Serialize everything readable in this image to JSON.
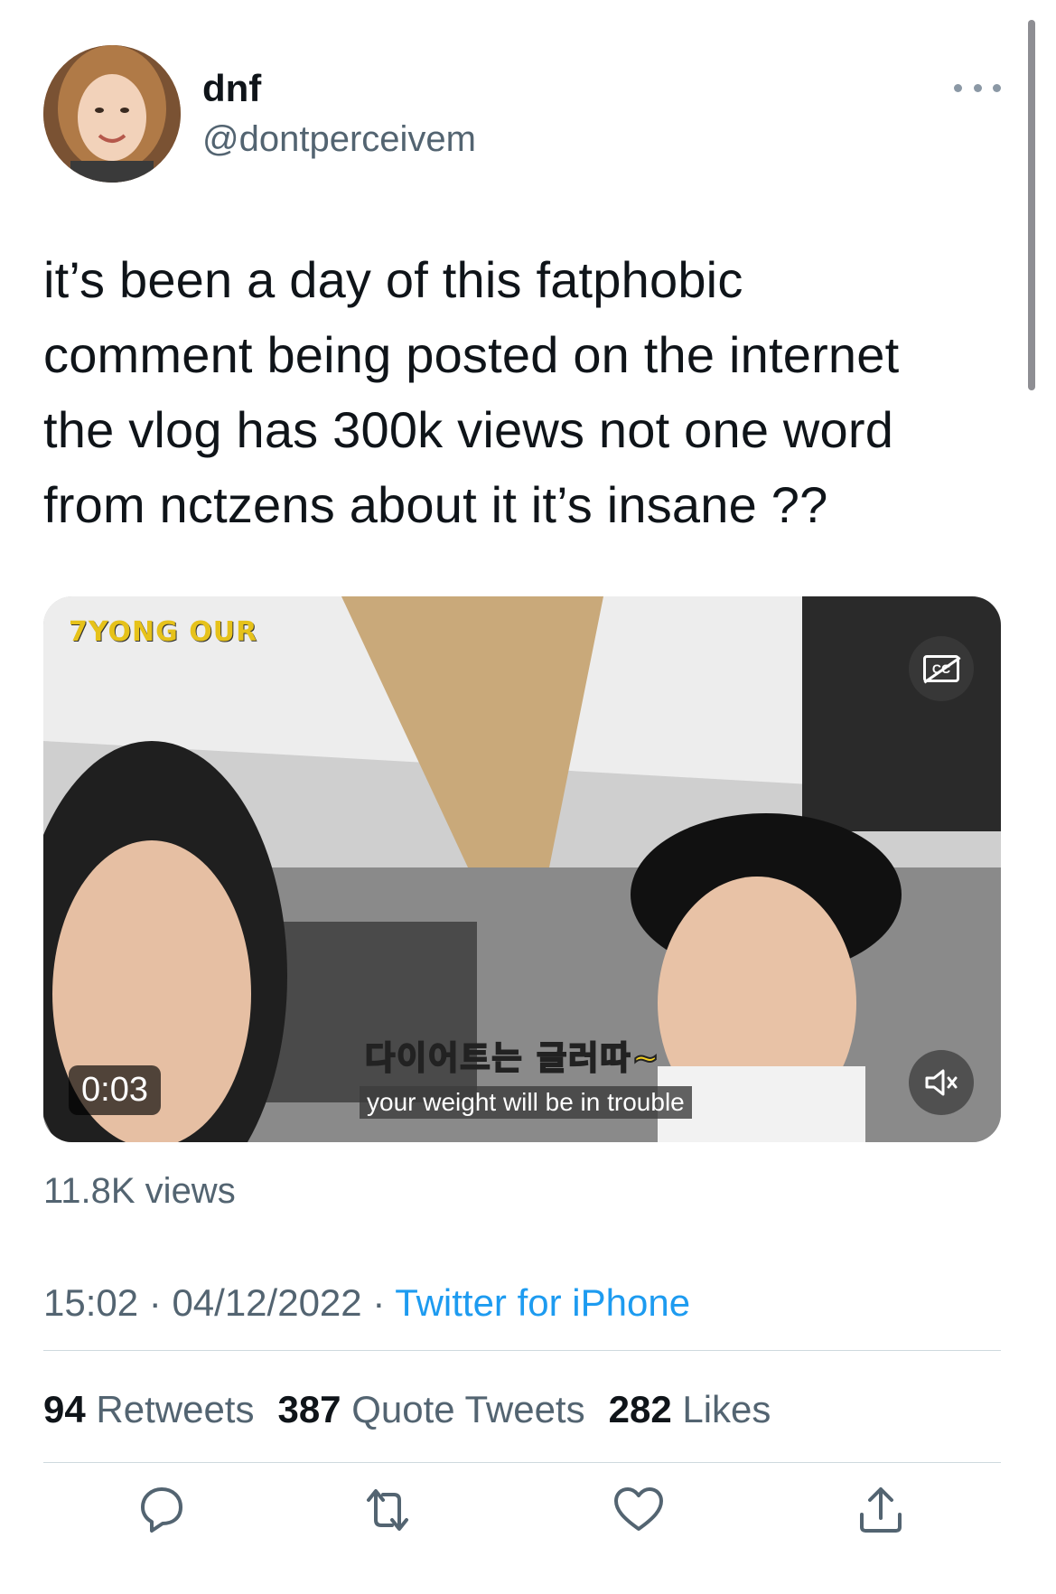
{
  "user": {
    "display_name": "dnf",
    "handle": "@dontperceivem"
  },
  "tweet": {
    "text": "it’s been a day of this fatphobic\ncomment being posted on the internet\nthe vlog has 300k views not one word\nfrom nctzens about it it’s insane ??"
  },
  "media": {
    "channel_logo": "7YONG OUR",
    "timestamp": "0:03",
    "subtitle_korean": "다이어트는 글러따~",
    "subtitle_english": "your weight will be in trouble",
    "cc_icon": "closed-captions-off-icon",
    "mute_icon": "speaker-muted-icon"
  },
  "views_label": "11.8K views",
  "meta": {
    "time": "15:02",
    "separator": " · ",
    "date": "04/12/2022",
    "source": "Twitter for iPhone"
  },
  "stats": {
    "retweets_count": "94",
    "retweets_label": "Retweets",
    "quotes_count": "387",
    "quotes_label": "Quote Tweets",
    "likes_count": "282",
    "likes_label": "Likes"
  },
  "actions": {
    "reply": "reply-icon",
    "retweet": "retweet-icon",
    "like": "heart-icon",
    "share": "share-icon"
  },
  "colors": {
    "text": "#0f1419",
    "secondary": "#536471",
    "link": "#1d9bf0",
    "divider": "#cfd9de"
  }
}
